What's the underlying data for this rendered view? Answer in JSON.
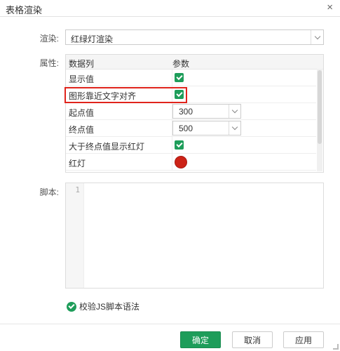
{
  "dialog": {
    "title": "表格渲染",
    "close_glyph": "×"
  },
  "render": {
    "label": "渲染:",
    "value": "红绿灯渲染"
  },
  "properties": {
    "label": "属性:",
    "columns": [
      "数据列",
      "参数"
    ],
    "rows": [
      {
        "name": "显示值",
        "type": "checkbox",
        "checked": true
      },
      {
        "name": "图形靠近文字对齐",
        "type": "checkbox",
        "checked": true
      },
      {
        "name": "起点值",
        "type": "number",
        "value": "300"
      },
      {
        "name": "终点值",
        "type": "number",
        "value": "500"
      },
      {
        "name": "大于终点值显示红灯",
        "type": "checkbox",
        "checked": true
      },
      {
        "name": "红灯",
        "type": "color",
        "color": "#cc2216"
      }
    ]
  },
  "script": {
    "label": "脚本:",
    "line_number": "1"
  },
  "validate": {
    "label": "校验JS脚本语法"
  },
  "buttons": {
    "confirm": "确定",
    "cancel": "取消",
    "apply": "应用"
  },
  "colors": {
    "accent": "#1e9d5a",
    "highlight": "#e0241c"
  }
}
